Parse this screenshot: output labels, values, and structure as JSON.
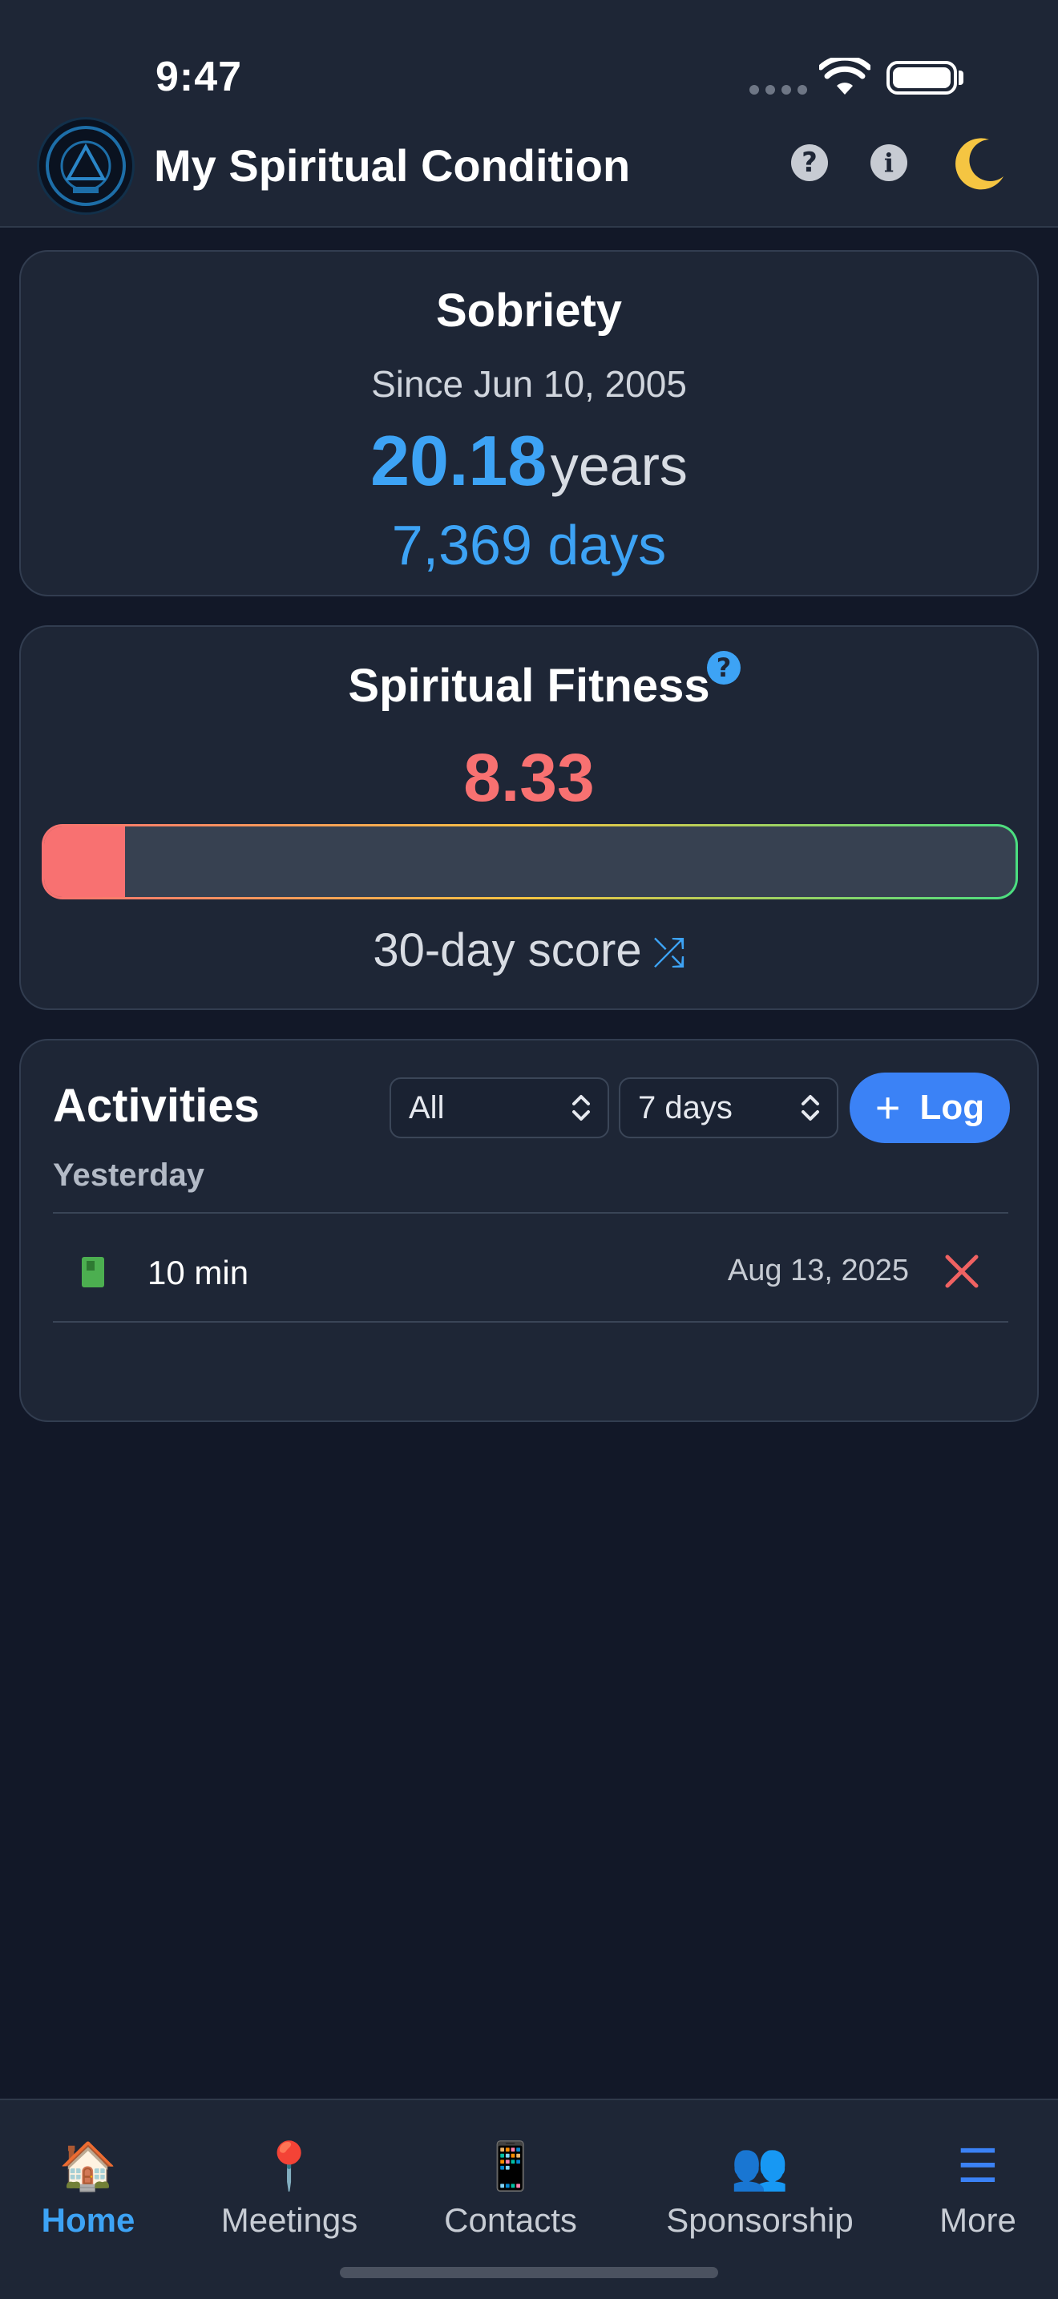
{
  "status_bar": {
    "time": "9:47"
  },
  "header": {
    "title": "My Spiritual Condition",
    "logo_icon": "app-logo-badge",
    "help_icon": "question-circle-icon",
    "info_icon": "info-circle-icon",
    "theme_icon": "moon-icon"
  },
  "sobriety": {
    "title": "Sobriety",
    "since": "Since Jun 10, 2005",
    "years_value": "20.18",
    "years_unit": "years",
    "days": "7,369 days"
  },
  "fitness": {
    "title": "Spiritual Fitness",
    "help_symbol": "?",
    "score": "8.33",
    "score_fraction": 0.0833,
    "caption": "30-day score",
    "shuffle_symbol": "⤮"
  },
  "activities": {
    "title": "Activities",
    "type_filter": "All",
    "range_filter": "7 days",
    "log_plus": "+",
    "log_label": "Log",
    "group_label": "Yesterday",
    "rows": [
      {
        "icon": "book-icon",
        "duration": "10 min",
        "date": "Aug 13, 2025"
      }
    ]
  },
  "bottom_nav": {
    "items": [
      {
        "label": "Home",
        "icon": "🏠",
        "active": true
      },
      {
        "label": "Meetings",
        "icon": "📍",
        "active": false
      },
      {
        "label": "Contacts",
        "icon": "📱",
        "active": false
      },
      {
        "label": "Sponsorship",
        "icon": "👥",
        "active": false
      },
      {
        "label": "More",
        "icon": "☰",
        "active": false
      }
    ]
  },
  "colors": {
    "accent_blue": "#3da3f5",
    "score_red": "#f87171",
    "button_blue": "#3b82f6",
    "background": "#121828",
    "card": "#1e2636"
  }
}
